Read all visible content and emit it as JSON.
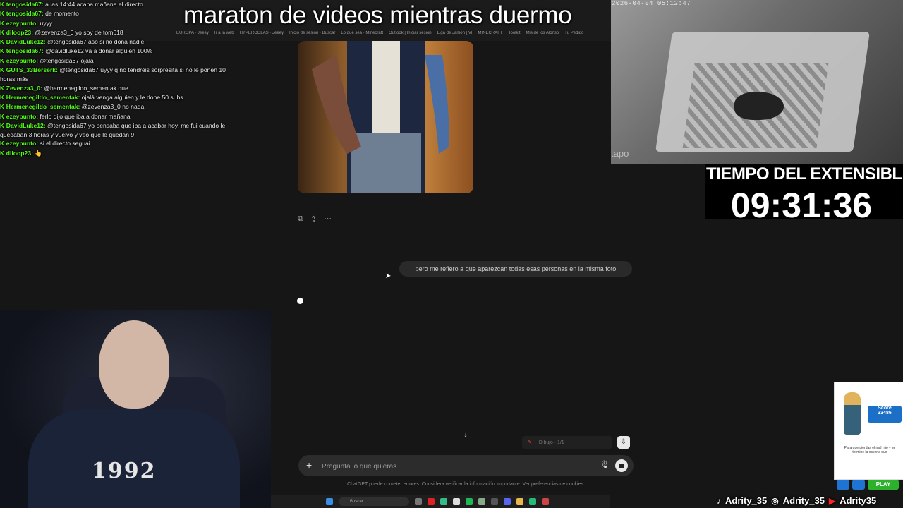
{
  "stream": {
    "title": "maraton de videos mientras duermo",
    "timer_label": "TIEMPO DEL EXTENSIBLE:",
    "timer_value": "09:31:36"
  },
  "camera": {
    "timestamp": "2026-04-04 05:12:47",
    "brand": "tapo"
  },
  "chat": {
    "messages": [
      {
        "user": "tengosida67:",
        "text": " a las 14:44 acaba mañana el directo"
      },
      {
        "user": "tengosida67:",
        "text": " de momento"
      },
      {
        "user": "ezeypunto:",
        "text": " uyyy"
      },
      {
        "user": "diloop23:",
        "text": " @zevenza3_0 yo soy de tom618"
      },
      {
        "user": "DavidLuke12:",
        "text": " @tengosida67 aso si no dona nadie"
      },
      {
        "user": "tengosida67:",
        "text": " @davidluke12 va a donar alguien 100%"
      },
      {
        "user": "ezeypunto:",
        "text": " @tengosida67 ojala"
      },
      {
        "user": "GUTS_33Berserk:",
        "text": " @tengosida67 uyyy q no tendréis sorpresita si no le ponen 10 horas más",
        "wrap": true
      },
      {
        "user": "Zevenza3_0:",
        "text": " @hermenegildo_sementak que"
      },
      {
        "user": "Hermenegildo_sementak:",
        "text": " ojalá venga alguien y le done 50 subs"
      },
      {
        "user": "Hermenegildo_sementak:",
        "text": " @zevenza3_0 no nada"
      },
      {
        "user": "ezeypunto:",
        "text": " ferlo dijo que iba a donar mañana"
      },
      {
        "user": "DavidLuke12:",
        "text": " @tengosida67 yo pensaba que iba a acabar hoy, me fui cuando le quedaban 3 horas y vuelvo y veo que le quedan 9",
        "wrap": true
      },
      {
        "user": "ezeypunto:",
        "text": " si el directo seguai"
      },
      {
        "user": "diloop23:",
        "text": " 👆"
      }
    ]
  },
  "chatgpt": {
    "user_message": "pero me refiero a que aparezcan todas esas personas en la misma foto",
    "composer_placeholder": "Pregunta lo que quieras",
    "disclaimer": "ChatGPT puede cometer errores. Considera verificar la información importante. Ver preferencias de cookies.",
    "image_actions": [
      "⧉",
      "⇪",
      "···"
    ],
    "mini_toolbar_label": "Dibujo · 1/1"
  },
  "browser": {
    "bookmarks": [
      "EUROPA · Jeeey",
      "Ir a la web",
      "HYPERCOLAS · Jeeey",
      "Inicio de sesión · Buscar",
      "Lo que sea · Minecraft",
      "Outlook | Iniciar sesión",
      "Liga de Jamón | VI",
      "MINECRAFT",
      "Toolkit",
      "Mis de los Alonso",
      "Tu Pedido"
    ]
  },
  "taskbar": {
    "search_label": "Buscar"
  },
  "streamer": {
    "shirt_text": "1992"
  },
  "ad": {
    "score_label": "Score",
    "score_value": "33486",
    "text": "Para que pierdas el mal hijo y se termine la escena que",
    "play_label": "PLAY"
  },
  "socials": [
    {
      "icon": "tiktok-icon",
      "handle": "Adrity_35"
    },
    {
      "icon": "instagram-icon",
      "handle": "Adrity_35"
    },
    {
      "icon": "youtube-icon",
      "handle": "Adrity35"
    }
  ],
  "colors": {
    "chat_username": "#53fc18",
    "background": "#161616"
  }
}
